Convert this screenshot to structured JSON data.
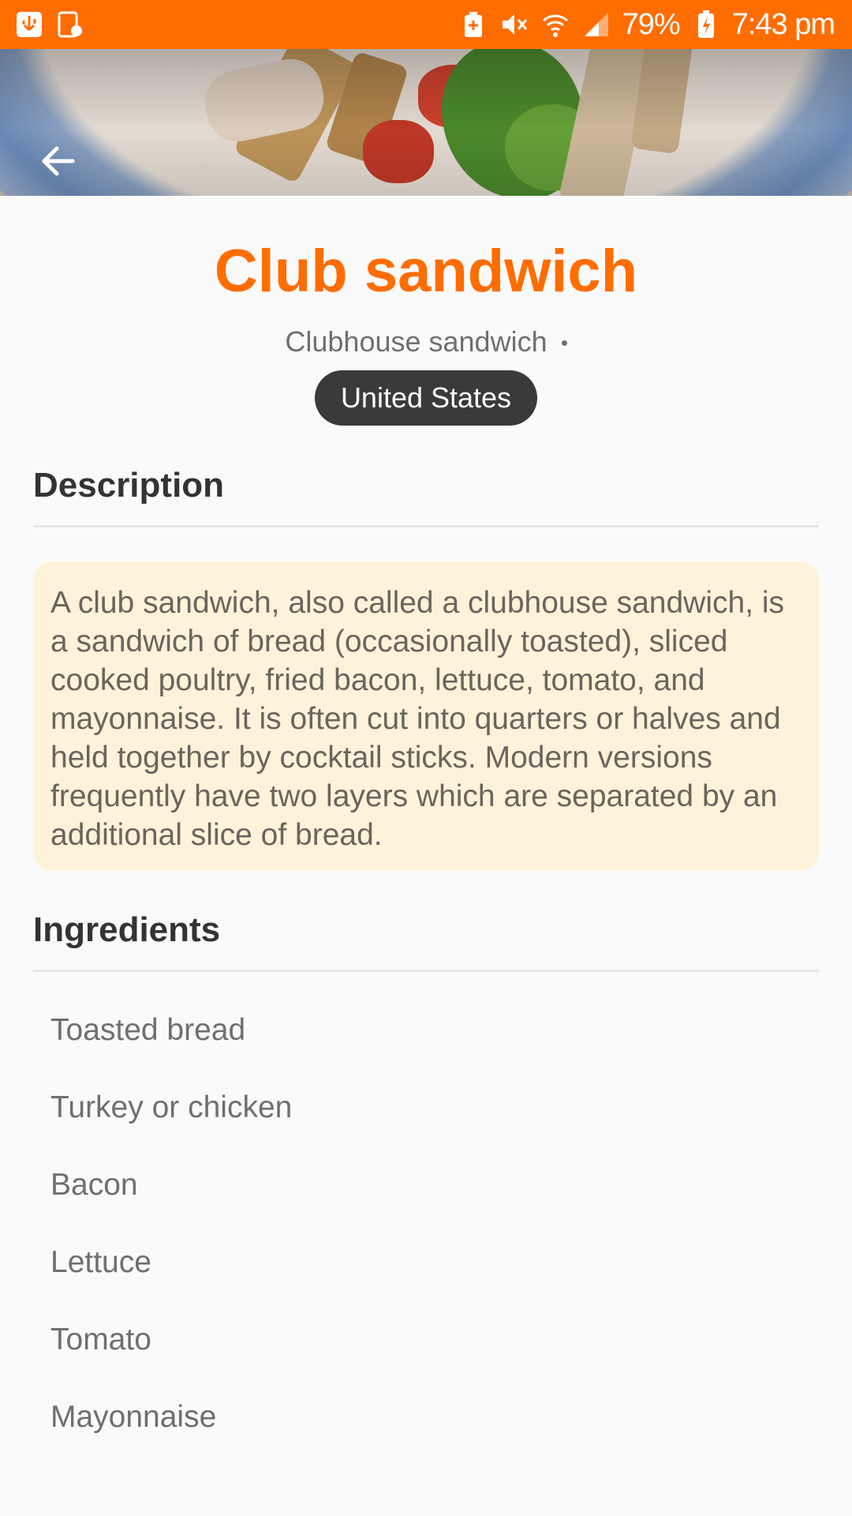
{
  "status_bar": {
    "battery_percent": "79%",
    "time": "7:43 pm",
    "icons": [
      "usb-icon",
      "screenshot-icon",
      "battery-saver-icon",
      "mute-icon",
      "wifi-icon",
      "signal-icon",
      "battery-charging-icon"
    ]
  },
  "header": {
    "title": "Club sandwich",
    "alt_name": "Clubhouse sandwich",
    "country": "United States"
  },
  "description": {
    "heading": "Description",
    "text": "A club sandwich, also called a clubhouse sandwich, is a sandwich of bread (occasionally toasted), sliced cooked poultry, fried bacon, lettuce, tomato, and mayonnaise. It is often cut into quarters or halves and held together by cocktail sticks. Modern versions frequently have two layers which are separated by an additional slice of bread."
  },
  "ingredients": {
    "heading": "Ingredients",
    "items": [
      "Toasted bread",
      "Turkey or chicken",
      "Bacon",
      "Lettuce",
      "Tomato",
      "Mayonnaise"
    ]
  },
  "colors": {
    "accent": "#ff6d00",
    "chip_bg": "#3a3a3a",
    "card_bg": "#fdf3da"
  }
}
